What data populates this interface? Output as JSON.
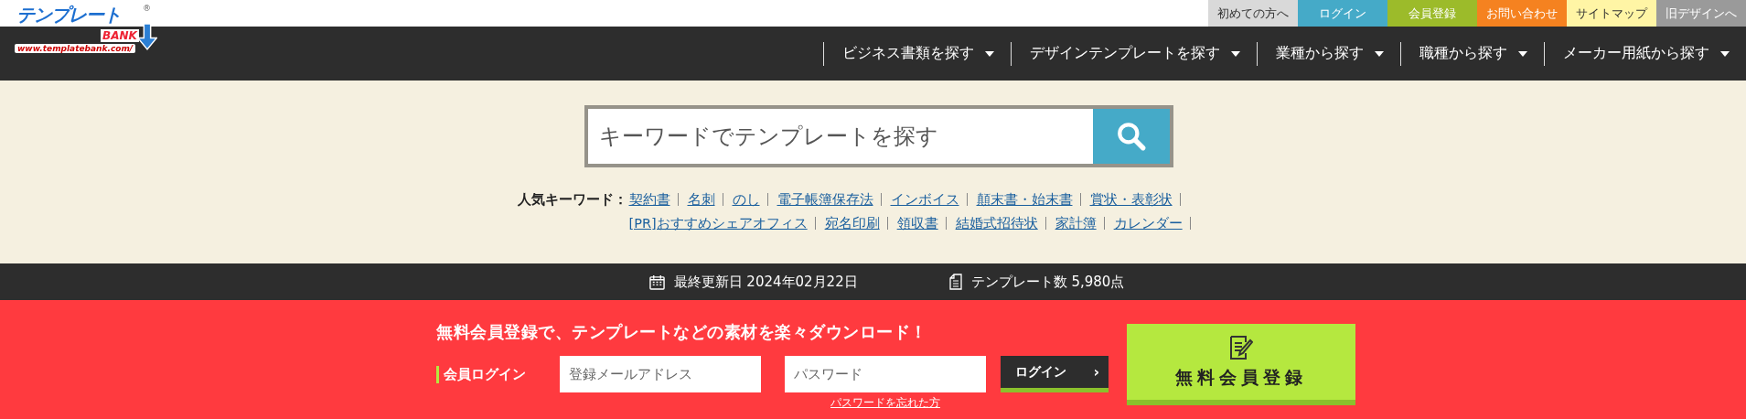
{
  "logo": {
    "title": "テンプレート",
    "badge": "BANK",
    "url": "www.templatebank.com/",
    "mark": "®"
  },
  "top_links": [
    {
      "label": "初めての方へ",
      "color": "#d9d9d9"
    },
    {
      "label": "ログイン",
      "color": "#45aac8"
    },
    {
      "label": "会員登録",
      "color": "#9cbb2a"
    },
    {
      "label": "お問い合わせ",
      "color": "#f58220"
    },
    {
      "label": "サイトマップ",
      "color": "#fff5a5"
    },
    {
      "label": "旧デザインへ",
      "color": "#9a9a9a"
    }
  ],
  "nav": [
    {
      "label": "ビジネス書類を探す"
    },
    {
      "label": "デザインテンプレートを探す"
    },
    {
      "label": "業種から探す"
    },
    {
      "label": "職種から探す"
    },
    {
      "label": "メーカー用紙から探す"
    }
  ],
  "search": {
    "placeholder": "キーワードでテンプレートを探す"
  },
  "popular": {
    "label": "人気キーワード：",
    "keywords": [
      "契約書",
      "名刺",
      "のし",
      "電子帳簿保存法",
      "インボイス",
      "顛末書・始末書",
      "賞状・表彰状",
      "[PR]おすすめシェアオフィス",
      "宛名印刷",
      "領収書",
      "結婚式招待状",
      "家計簿",
      "カレンダー"
    ]
  },
  "stats": [
    {
      "kind": "calendar",
      "text": "最終更新日 2024年02月22日"
    },
    {
      "kind": "document",
      "text": "テンプレート数 5,980点"
    }
  ],
  "signup": {
    "headline": "無料会員登録で、テンプレートなどの素材を楽々ダウンロード！",
    "login_label": "会員ログイン",
    "email_placeholder": "登録メールアドレス",
    "password_placeholder": "パスワード",
    "login_button": "ログイン",
    "login_button_icon": "›",
    "forgot_link": "パスワードを忘れた方",
    "register_button": "無料会員登録"
  }
}
